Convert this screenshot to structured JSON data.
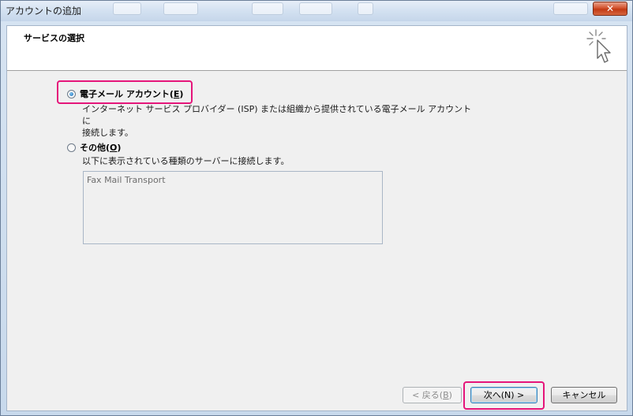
{
  "window": {
    "title": "アカウントの追加",
    "close_glyph": "✕"
  },
  "header": {
    "title": "サービスの選択",
    "icon": "wizard-cursor-icon"
  },
  "options": [
    {
      "label_prefix": "電子メール アカウント(",
      "accesskey": "E",
      "label_suffix": ")",
      "selected": true,
      "description_line1": "インターネット サービス プロバイダー (ISP) または組織から提供されている電子メール アカウントに",
      "description_line2": "接続します。"
    },
    {
      "label_prefix": "その他(",
      "accesskey": "O",
      "label_suffix": ")",
      "selected": false,
      "description_line1": "以下に表示されている種類のサーバーに接続します。"
    }
  ],
  "other_list": {
    "items": [
      "Fax Mail Transport"
    ]
  },
  "buttons": {
    "back_prefix": "< 戻る(",
    "back_accesskey": "B",
    "back_suffix": ")",
    "next": "次へ(N) >",
    "cancel": "キャンセル"
  },
  "colors": {
    "highlight": "#e5157a",
    "radio_fill": "#1e6fb8"
  }
}
